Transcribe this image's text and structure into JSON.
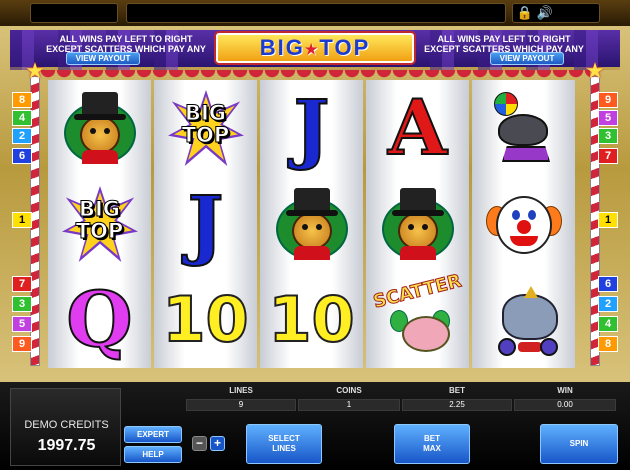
{
  "game": {
    "logo": {
      "word1": "BIG",
      "word2": "TOP",
      "star": "★"
    },
    "rules_left": "ALL WINS PAY LEFT TO RIGHT\nEXCEPT SCATTERS WHICH PAY ANY",
    "rules_right": "ALL WINS PAY LEFT TO RIGHT\nEXCEPT SCATTERS WHICH PAY ANY",
    "view_payout_label": "VIEW PAYOUT"
  },
  "topbar": {
    "icons": [
      "lock-icon",
      "speaker-icon"
    ],
    "lock_glyph": "🔒",
    "speaker_glyph": "🔊"
  },
  "line_numbers": {
    "left": [
      "8",
      "4",
      "2",
      "6",
      "1",
      "7",
      "3",
      "5",
      "9"
    ],
    "right": [
      "9",
      "5",
      "3",
      "7",
      "1",
      "6",
      "2",
      "4",
      "8"
    ],
    "colors": {
      "1": "#ffe000",
      "2": "#20a0ff",
      "3": "#30c030",
      "4": "#30c030",
      "5": "#c040e0",
      "6": "#2040e0",
      "7": "#e02020",
      "8": "#ff9a00",
      "9": "#ff5a20"
    }
  },
  "reels": [
    [
      "lion",
      "big-top",
      "queen"
    ],
    [
      "big-top",
      "jack",
      "ten"
    ],
    [
      "jack",
      "lion",
      "ten"
    ],
    [
      "ace",
      "lion",
      "scatter"
    ],
    [
      "seal",
      "clown",
      "elephant"
    ]
  ],
  "symbols": {
    "jack": "J",
    "queen": "Q",
    "ace": "A",
    "ten": "10",
    "big_top_line1": "BIG",
    "big_top_line2": "TOP",
    "scatter": "SCATTER"
  },
  "stats": {
    "lines_label": "LINES",
    "lines_value": "9",
    "coins_label": "COINS",
    "coins_value": "1",
    "bet_label": "BET",
    "bet_value": "2.25",
    "win_label": "WIN",
    "win_value": "0.00"
  },
  "credits": {
    "label": "DEMO CREDITS",
    "value": "1997.75"
  },
  "buttons": {
    "expert": "EXPERT",
    "help": "HELP",
    "minus": "−",
    "plus": "+",
    "select_lines": "SELECT\nLINES",
    "bet_max": "BET\nMAX",
    "spin": "SPIN"
  },
  "colors": {
    "accent": "#1856c8",
    "tent": "#3a1b86",
    "stripe_red": "#d0263a",
    "gold": "#d8c27a"
  }
}
